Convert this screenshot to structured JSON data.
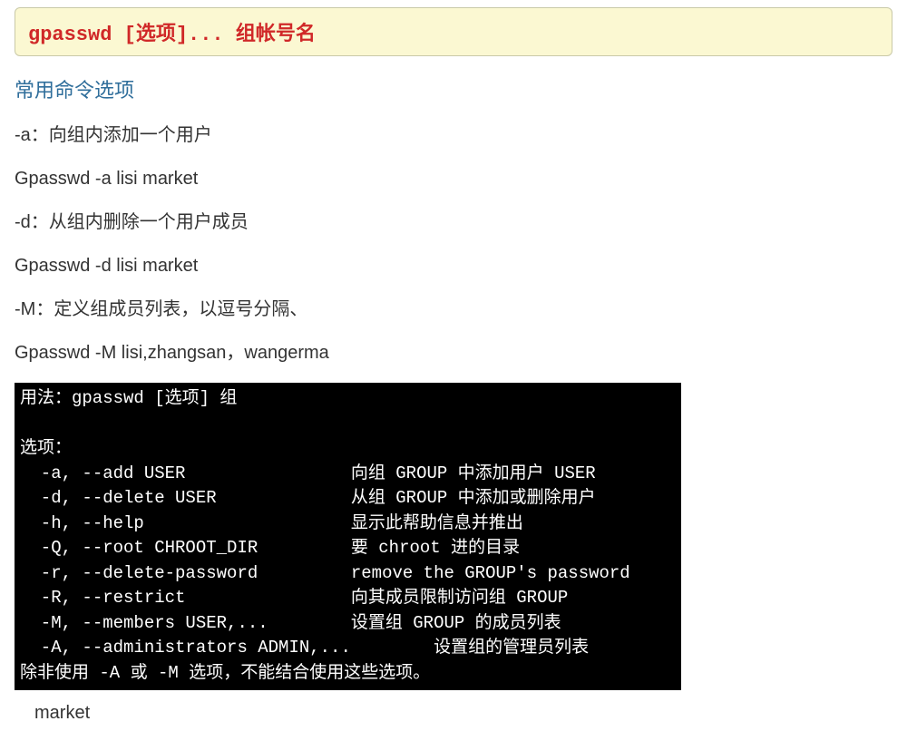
{
  "syntax_box": "gpasswd [选项]... 组帐号名",
  "section_title": "常用命令选项",
  "lines": [
    "-a：向组内添加一个用户",
    "Gpasswd  -a  lisi   market",
    "-d：从组内删除一个用户成员",
    "Gpasswd  -d  lisi   market",
    "-M：定义组成员列表，以逗号分隔、",
    "Gpasswd  -M  lisi,zhangsan，wangerma"
  ],
  "terminal": "用法：gpasswd [选项] 组\n\n选项：\n  -a, --add USER                向组 GROUP 中添加用户 USER\n  -d, --delete USER             从组 GROUP 中添加或删除用户\n  -h, --help                    显示此帮助信息并推出\n  -Q, --root CHROOT_DIR         要 chroot 进的目录\n  -r, --delete-password         remove the GROUP's password\n  -R, --restrict                向其成员限制访问组 GROUP\n  -M, --members USER,...        设置组 GROUP 的成员列表\n  -A, --administrators ADMIN,...        设置组的管理员列表\n除非使用 -A 或 -M 选项，不能结合使用这些选项。",
  "trailing_text": "market"
}
